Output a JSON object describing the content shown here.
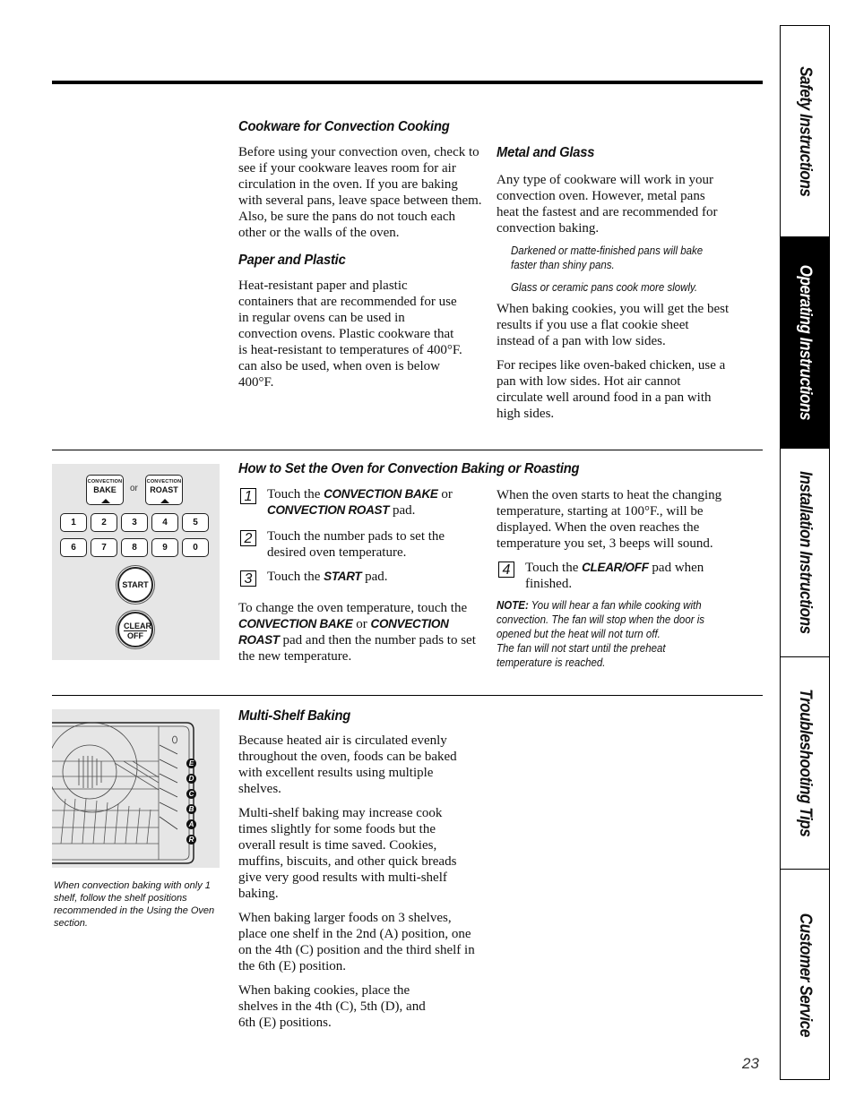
{
  "section1": {
    "cookware": {
      "heading": "Cookware for Convection Cooking",
      "body": "Before using your convection oven, check to see if your cookware leaves room for air circulation in the oven. If you are baking with several pans, leave space between them. Also, be sure the pans do not touch each other or the walls of the oven."
    },
    "paper_plastic": {
      "heading": "Paper and Plastic",
      "body": "Heat-resistant paper and plastic containers that are recommended for use in regular ovens can be used in convection ovens. Plastic cookware that is heat-resistant to temperatures of 400°F. can also be used, when oven is below 400°F."
    },
    "metal_glass": {
      "heading": "Metal and Glass",
      "body": "Any type of cookware will work in your convection oven. However, metal pans heat the fastest and are recommended for convection baking.",
      "note1": "Darkened or matte-finished pans will bake faster than shiny pans.",
      "note2": "Glass or ceramic pans cook more slowly.",
      "body2": "When baking cookies, you will get the best results if you use a flat cookie sheet instead of a pan with low sides.",
      "body3": "For recipes like oven-baked chicken, use a pan with low sides. Hot air cannot circulate well around food in a pan with high sides."
    }
  },
  "section2": {
    "heading": "How to Set the Oven for Convection Baking or Roasting",
    "keypad": {
      "conv_small": "CONVECTION",
      "bake": "BAKE",
      "roast": "ROAST",
      "or": "or",
      "numbers_row1": [
        "1",
        "2",
        "3",
        "4",
        "5"
      ],
      "numbers_row2": [
        "6",
        "7",
        "8",
        "9",
        "0"
      ],
      "start": "START",
      "clear": "CLEAR",
      "off": "OFF"
    },
    "steps": [
      {
        "num": "1",
        "pre": "Touch the ",
        "kw1": "CONVECTION BAKE",
        "mid": " or ",
        "kw2": "CONVECTION ROAST",
        "post": " pad."
      },
      {
        "num": "2",
        "text": "Touch the number pads to set the desired oven temperature."
      },
      {
        "num": "3",
        "pre": "Touch the ",
        "kw1": "START",
        "post": " pad."
      },
      {
        "num": "4",
        "pre": "Touch the ",
        "kw1": "CLEAR/OFF",
        "post": " pad when finished."
      }
    ],
    "change_temp": {
      "pre": "To change the oven temperature, touch the ",
      "kw1": "CONVECTION BAKE",
      "mid": " or ",
      "kw2": "CONVECTION ROAST",
      "post": " pad and then the number pads to set the new temperature."
    },
    "heat_text": "When the oven starts to heat the changing temperature, starting at 100°F., will be displayed. When the oven reaches the temperature you set, 3 beeps will sound.",
    "note_label": "NOTE:",
    "note_text": " You will hear a fan while cooking with convection. The fan will stop when the door is opened but the heat will not turn off.",
    "note_text2": "The fan will not start until the preheat temperature is reached."
  },
  "section3": {
    "heading": "Multi-Shelf Baking",
    "shelf_labels": [
      "E",
      "D",
      "C",
      "B",
      "A",
      "R"
    ],
    "caption": "When convection baking with only 1 shelf, follow the shelf positions recommended in the Using the Oven section.",
    "p1": "Because heated air is circulated evenly throughout the oven, foods can be baked with excellent results using multiple shelves.",
    "p2": "Multi-shelf baking may increase cook times slightly for some foods but the overall result is time saved. Cookies, muffins, biscuits, and other quick breads give very good results with multi-shelf baking.",
    "p3": "When baking larger foods on 3 shelves, place one shelf in the 2nd (A) position, one on the 4th (C) position and the third shelf in the 6th (E) position.",
    "p4": "When baking cookies, place the shelves in the 4th (C), 5th (D), and 6th (E) positions."
  },
  "side_tabs": [
    {
      "label": "Safety Instructions",
      "active": false
    },
    {
      "label": "Operating Instructions",
      "active": true
    },
    {
      "label": "Installation Instructions",
      "active": false
    },
    {
      "label": "Troubleshooting Tips",
      "active": false
    },
    {
      "label": "Customer Service",
      "active": false
    }
  ],
  "page_number": "23"
}
